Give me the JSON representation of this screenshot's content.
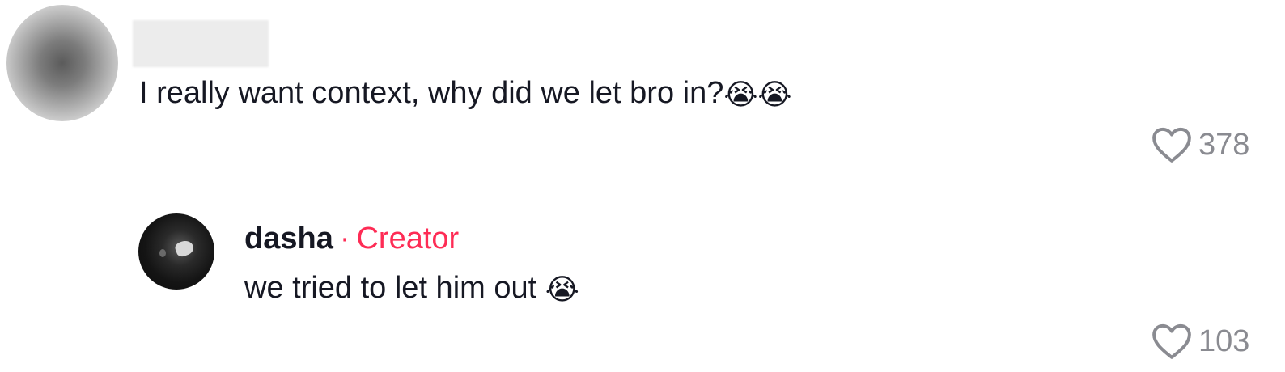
{
  "comment": {
    "text": "I really want context, why did we let bro in?",
    "emojis": "😭😭",
    "likes": "378"
  },
  "reply": {
    "username": "dasha",
    "separator": "·",
    "badge": "Creator",
    "text": "we tried to let him out",
    "emoji": "😭",
    "likes": "103"
  },
  "colors": {
    "text": "#161823",
    "accent": "#fe2c55",
    "muted": "#8a8b91"
  }
}
